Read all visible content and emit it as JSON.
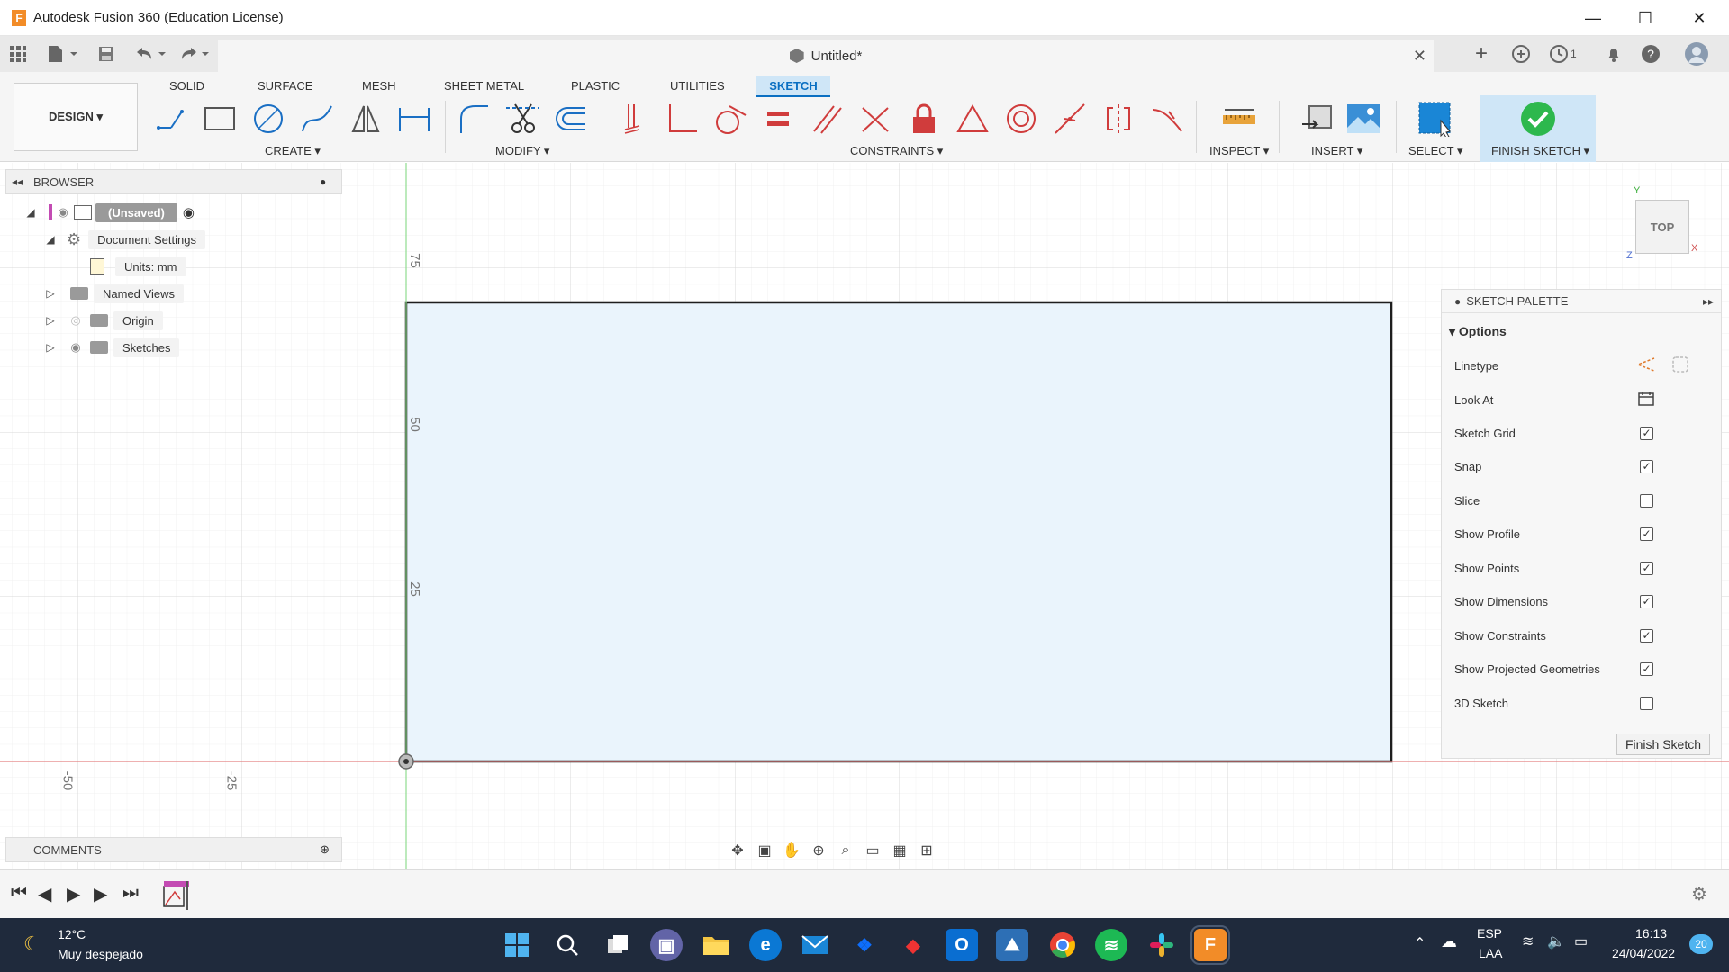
{
  "window": {
    "title": "Autodesk Fusion 360 (Education License)",
    "logo_letter": "F",
    "minimize": "—",
    "maximize": "☐",
    "close": "✕"
  },
  "quick_access": {
    "doc_title": "Untitled*",
    "doc_close": "✕",
    "notifications_count": "1"
  },
  "ribbon": {
    "workspace": "DESIGN ▾",
    "tabs": [
      {
        "label": "SOLID",
        "active": false
      },
      {
        "label": "SURFACE",
        "active": false
      },
      {
        "label": "MESH",
        "active": false
      },
      {
        "label": "SHEET METAL",
        "active": false
      },
      {
        "label": "PLASTIC",
        "active": false
      },
      {
        "label": "UTILITIES",
        "active": false
      },
      {
        "label": "SKETCH",
        "active": true
      }
    ],
    "groups": {
      "create": "CREATE ▾",
      "modify": "MODIFY ▾",
      "constraints": "CONSTRAINTS ▾",
      "inspect": "INSPECT ▾",
      "insert": "INSERT ▾",
      "select": "SELECT ▾",
      "finish": "FINISH SKETCH ▾"
    }
  },
  "browser": {
    "header": "BROWSER",
    "root": "(Unsaved)",
    "items": [
      {
        "label": "Document Settings",
        "icon": "gear-icon"
      },
      {
        "label": "Units: mm",
        "icon": "document-icon"
      },
      {
        "label": "Named Views",
        "icon": "folder-icon"
      },
      {
        "label": "Origin",
        "icon": "folder-icon"
      },
      {
        "label": "Sketches",
        "icon": "folder-icon"
      }
    ]
  },
  "comments": {
    "header": "COMMENTS"
  },
  "canvas": {
    "axis_labels": [
      "75",
      "50",
      "25",
      "-50",
      "-25"
    ],
    "viewcube_label": "TOP",
    "axis_y": "Y",
    "axis_x": "X",
    "axis_z": "Z",
    "colors": {
      "rect_fill": "#eaf4fc",
      "x_axis": "#e06666",
      "y_axis": "#7fd67f",
      "grid": "#e4e4e4"
    }
  },
  "palette": {
    "header": "SKETCH PALETTE",
    "section": "Options",
    "rows": [
      {
        "label": "Linetype",
        "type": "icons"
      },
      {
        "label": "Look At",
        "type": "icon"
      },
      {
        "label": "Sketch Grid",
        "checked": true
      },
      {
        "label": "Snap",
        "checked": true
      },
      {
        "label": "Slice",
        "checked": false
      },
      {
        "label": "Show Profile",
        "checked": true
      },
      {
        "label": "Show Points",
        "checked": true
      },
      {
        "label": "Show Dimensions",
        "checked": true
      },
      {
        "label": "Show Constraints",
        "checked": true
      },
      {
        "label": "Show Projected Geometries",
        "checked": true
      },
      {
        "label": "3D Sketch",
        "checked": false
      }
    ],
    "finish_button": "Finish Sketch"
  },
  "taskbar": {
    "weather_temp": "12°C",
    "weather_desc": "Muy despejado",
    "lang": "ESP",
    "lang_sub": "LAA",
    "time": "16:13",
    "date": "24/04/2022",
    "notif_count": "20"
  }
}
